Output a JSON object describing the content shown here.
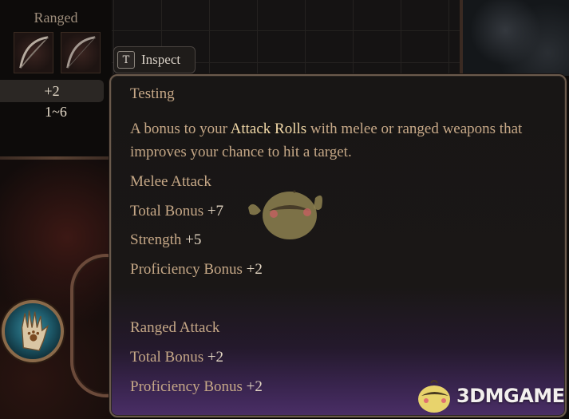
{
  "equipment": {
    "section_title": "Ranged",
    "slots": [
      {
        "icon": "bow-icon"
      },
      {
        "icon": "bow-icon"
      }
    ],
    "attack_bonus": "+2",
    "damage_range": "1~6"
  },
  "inspect": {
    "key": "T",
    "label": "Inspect"
  },
  "tooltip": {
    "title": "Testing",
    "description_prefix": "A bonus to your ",
    "description_highlight": "Attack Rolls",
    "description_suffix": " with melee or ranged weapons that improves your chance to hit a target.",
    "melee": {
      "heading": "Melee Attack",
      "rows": [
        {
          "label": "Total Bonus",
          "value": "+7"
        },
        {
          "label": "Strength",
          "value": "+5"
        },
        {
          "label": "Proficiency Bonus",
          "value": "+2"
        }
      ]
    },
    "ranged": {
      "heading": "Ranged Attack",
      "rows": [
        {
          "label": "Total Bonus",
          "value": "+2"
        },
        {
          "label": "Proficiency Bonus",
          "value": "+2"
        }
      ]
    }
  },
  "watermark": {
    "text": "3DMGAME"
  },
  "colors": {
    "tooltip_text": "#c6a887",
    "value_text": "#e3d6c3",
    "highlight_text": "#f2d9a8",
    "tooltip_border": "#6a5a4c",
    "tooltip_bottom_glow": "#4a2e66"
  }
}
